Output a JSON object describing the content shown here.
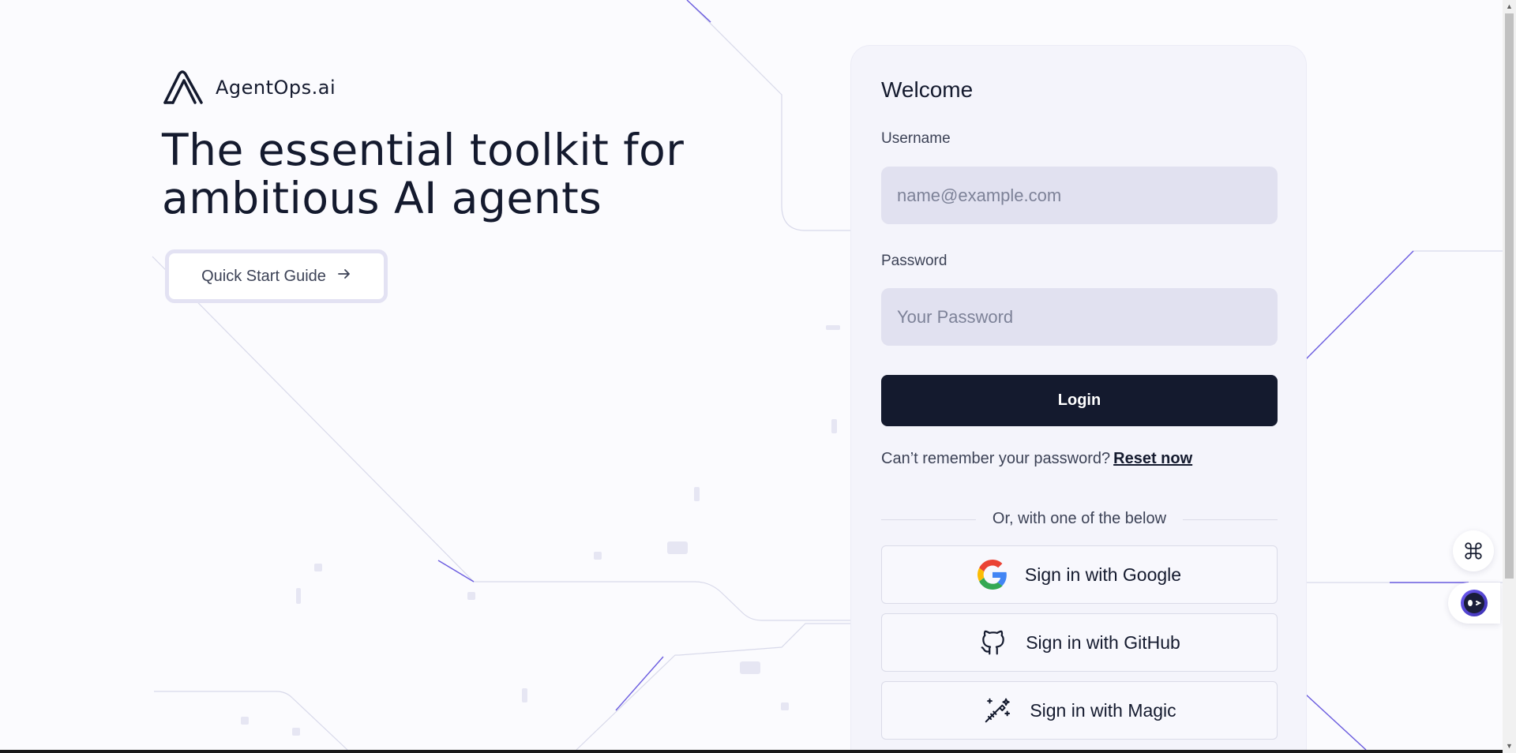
{
  "brand": {
    "name": "AgentOps.ai",
    "logo_icon": "agentops-logo-icon"
  },
  "hero": {
    "title_line1": "The essential toolkit for",
    "title_line2": "ambitious AI agents",
    "cta_label": "Quick Start Guide",
    "cta_icon": "arrow-right-icon"
  },
  "login": {
    "welcome": "Welcome",
    "username_label": "Username",
    "username_placeholder": "name@example.com",
    "username_value": "",
    "password_label": "Password",
    "password_placeholder": "Your Password",
    "password_value": "",
    "login_button": "Login",
    "reset_prompt": "Can’t remember your password?",
    "reset_link": "Reset now",
    "divider_text": "Or, with one of the below",
    "oauth": [
      {
        "label": "Sign in with Google",
        "icon": "google-icon"
      },
      {
        "label": "Sign in with GitHub",
        "icon": "github-icon"
      },
      {
        "label": "Sign in with Magic",
        "icon": "magic-wand-icon"
      }
    ]
  },
  "colors": {
    "primary": "#141a2e",
    "accent": "#5b4bd8",
    "field_bg": "#e1e1f0",
    "card_bg": "#f4f4fb"
  }
}
